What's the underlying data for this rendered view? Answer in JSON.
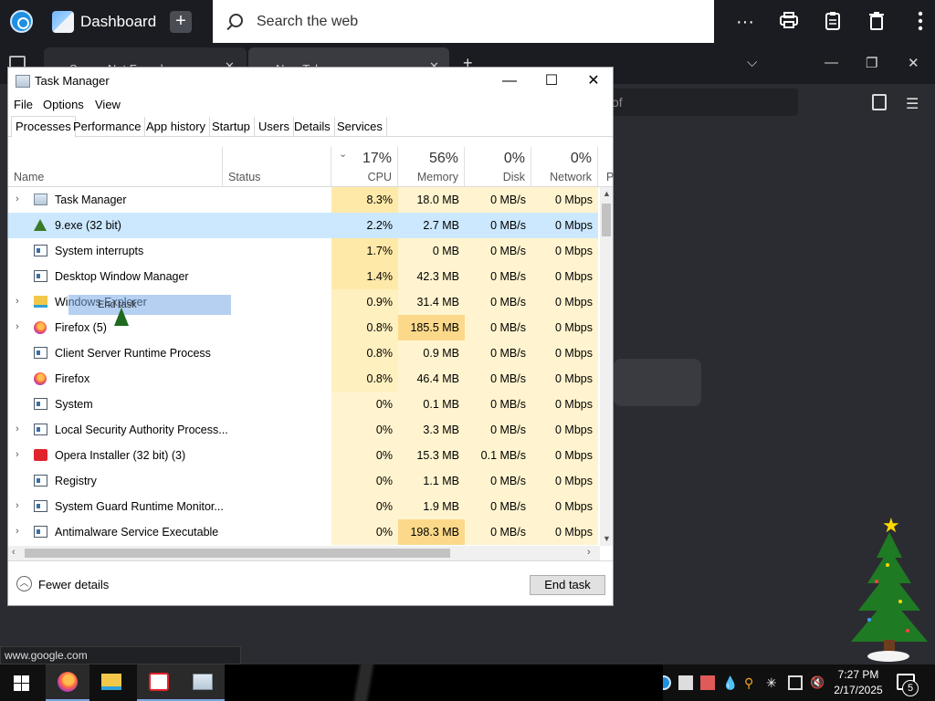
{
  "browser": {
    "dashboard_label": "Dashboard",
    "add_label": "+",
    "search_placeholder": "Search the web",
    "more_label": "···",
    "tabs": [
      {
        "label": "Server Not Found"
      },
      {
        "label": "New Tab"
      }
    ],
    "new_tab_label": "+",
    "addr_fragment": "of",
    "status_url": "www.google.com"
  },
  "task_manager": {
    "title": "Task Manager",
    "menu": [
      "File",
      "Options",
      "View"
    ],
    "tabs": [
      "Processes",
      "Performance",
      "App history",
      "Startup",
      "Users",
      "Details",
      "Services"
    ],
    "active_tab": "Processes",
    "columns": {
      "name": "Name",
      "status": "Status",
      "cpu": {
        "pct": "17%",
        "label": "CPU"
      },
      "memory": {
        "pct": "56%",
        "label": "Memory"
      },
      "disk": {
        "pct": "0%",
        "label": "Disk"
      },
      "network": {
        "pct": "0%",
        "label": "Network"
      },
      "extra": "P"
    },
    "processes": [
      {
        "name": "Task Manager",
        "expand": true,
        "icon": "task-manager-icon",
        "cpu": "8.3%",
        "mem": "18.0 MB",
        "disk": "0 MB/s",
        "net": "0 Mbps"
      },
      {
        "name": "9.exe (32 bit)",
        "expand": false,
        "icon": "tree-icon",
        "cpu": "2.2%",
        "mem": "2.7 MB",
        "disk": "0 MB/s",
        "net": "0 Mbps",
        "selected": true
      },
      {
        "name": "System interrupts",
        "expand": false,
        "icon": "window-icon",
        "cpu": "1.7%",
        "mem": "0 MB",
        "disk": "0 MB/s",
        "net": "0 Mbps"
      },
      {
        "name": "Desktop Window Manager",
        "expand": false,
        "icon": "window-icon",
        "cpu": "1.4%",
        "mem": "42.3 MB",
        "disk": "0 MB/s",
        "net": "0 Mbps"
      },
      {
        "name": "Windows Explorer",
        "expand": true,
        "icon": "folder-icon",
        "cpu": "0.9%",
        "mem": "31.4 MB",
        "disk": "0 MB/s",
        "net": "0 Mbps"
      },
      {
        "name": "Firefox (5)",
        "expand": true,
        "icon": "firefox-icon",
        "cpu": "0.8%",
        "mem": "185.5 MB",
        "disk": "0 MB/s",
        "net": "0 Mbps"
      },
      {
        "name": "Client Server Runtime Process",
        "expand": false,
        "icon": "window-icon",
        "cpu": "0.8%",
        "mem": "0.9 MB",
        "disk": "0 MB/s",
        "net": "0 Mbps"
      },
      {
        "name": "Firefox",
        "expand": false,
        "icon": "firefox-icon",
        "cpu": "0.8%",
        "mem": "46.4 MB",
        "disk": "0 MB/s",
        "net": "0 Mbps"
      },
      {
        "name": "System",
        "expand": false,
        "icon": "window-icon",
        "cpu": "0%",
        "mem": "0.1 MB",
        "disk": "0 MB/s",
        "net": "0 Mbps"
      },
      {
        "name": "Local Security Authority Process...",
        "expand": true,
        "icon": "window-icon",
        "cpu": "0%",
        "mem": "3.3 MB",
        "disk": "0 MB/s",
        "net": "0 Mbps"
      },
      {
        "name": "Opera Installer (32 bit) (3)",
        "expand": true,
        "icon": "opera-icon",
        "cpu": "0%",
        "mem": "15.3 MB",
        "disk": "0.1 MB/s",
        "net": "0 Mbps"
      },
      {
        "name": "Registry",
        "expand": false,
        "icon": "window-icon",
        "cpu": "0%",
        "mem": "1.1 MB",
        "disk": "0 MB/s",
        "net": "0 Mbps"
      },
      {
        "name": "System Guard Runtime Monitor...",
        "expand": true,
        "icon": "window-icon",
        "cpu": "0%",
        "mem": "1.9 MB",
        "disk": "0 MB/s",
        "net": "0 Mbps"
      },
      {
        "name": "Antimalware Service Executable",
        "expand": true,
        "icon": "window-icon",
        "cpu": "0%",
        "mem": "198.3 MB",
        "disk": "0 MB/s",
        "net": "0 Mbps"
      }
    ],
    "fewer_details": "Fewer details",
    "end_task": "End task",
    "drag_ghost_label": "End task",
    "colors": {
      "cpu_high": "#ffe9a8",
      "cpu_mid": "#fff0bf",
      "cpu_low": "#fff4cf",
      "mem_high": "#fcd98a",
      "default_cell": "#fff4cf",
      "selected": "#cce8ff"
    }
  },
  "taskbar": {
    "time": "7:27 PM",
    "date": "2/17/2025",
    "notification_count": "5"
  }
}
